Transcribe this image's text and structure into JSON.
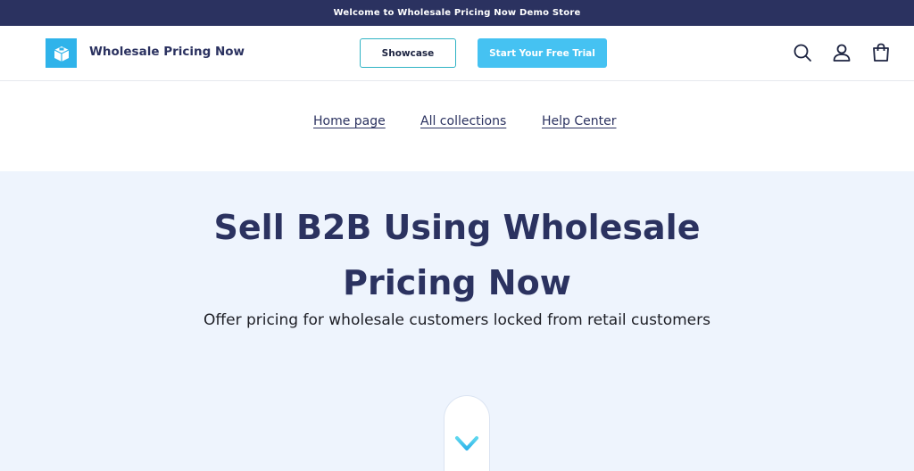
{
  "announcement": {
    "text": "Welcome to Wholesale Pricing Now Demo Store"
  },
  "header": {
    "brand_name": "Wholesale Pricing Now",
    "showcase_label": "Showcase",
    "trial_label": "Start Your Free Trial",
    "icons": [
      "search-icon",
      "account-icon",
      "cart-icon"
    ]
  },
  "nav": {
    "links": [
      {
        "label": "Home page"
      },
      {
        "label": "All collections"
      },
      {
        "label": "Help Center"
      }
    ]
  },
  "hero": {
    "title": "Sell B2B Using Wholesale Pricing Now",
    "subtitle": "Offer pricing for wholesale customers locked from retail customers"
  },
  "colors": {
    "primary_dark": "#2b3260",
    "accent_blue": "#45c2f2",
    "hero_background": "#eef4fd"
  }
}
